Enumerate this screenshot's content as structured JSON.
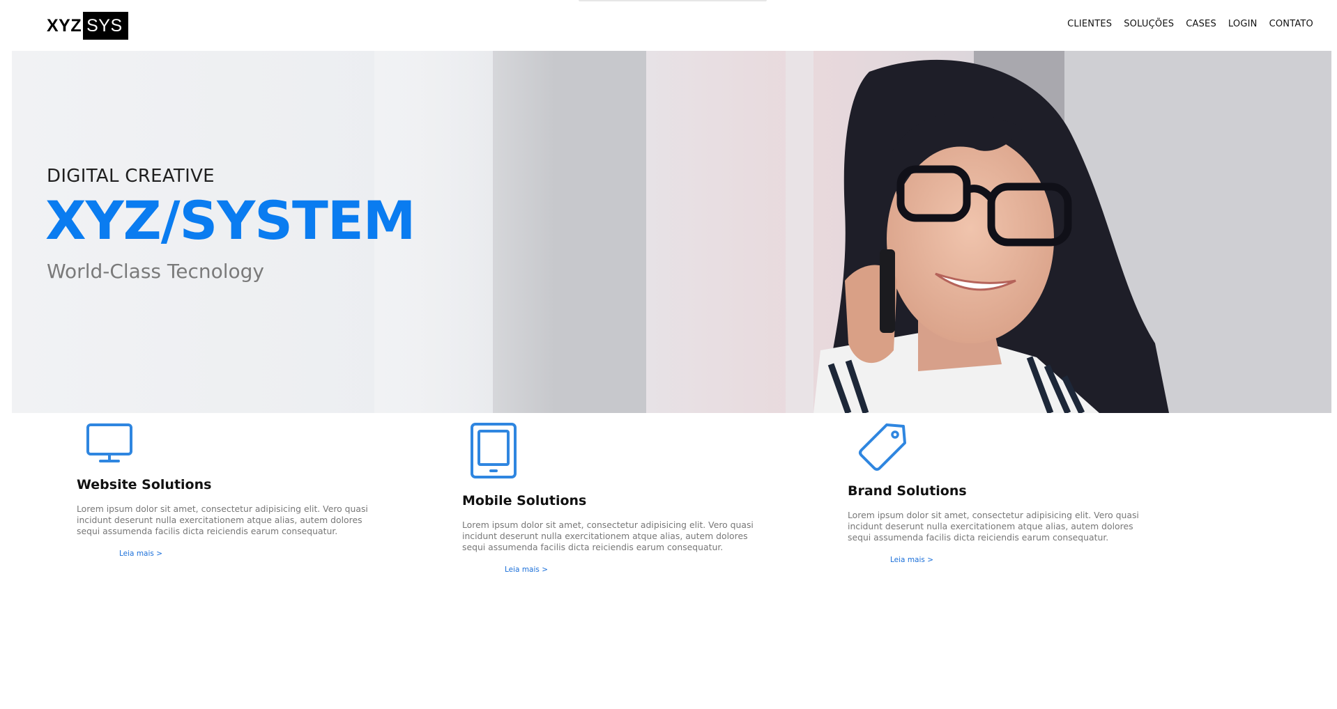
{
  "brand": {
    "logo_left": "XYZ",
    "logo_right": "SYS"
  },
  "nav": {
    "items": [
      "CLIENTES",
      "SOLUÇÕES",
      "CASES",
      "LOGIN",
      "CONTATO"
    ]
  },
  "hero": {
    "kicker": "DIGITAL CREATIVE",
    "title": "XYZ/SYSTEM",
    "subtitle": "World-Class Tecnology"
  },
  "features": [
    {
      "icon": "monitor-icon",
      "title": "Website Solutions",
      "text": "Lorem ipsum dolor sit amet, consectetur adipisicing elit. Vero quasi incidunt deserunt nulla exercitationem atque alias, autem dolores sequi assumenda facilis dicta reiciendis earum consequatur.",
      "link": "Leia mais >"
    },
    {
      "icon": "tablet-icon",
      "title": "Mobile Solutions",
      "text": "Lorem ipsum dolor sit amet, consectetur adipisicing elit. Vero quasi incidunt deserunt nulla exercitationem atque alias, autem dolores sequi assumenda facilis dicta reiciendis earum consequatur.",
      "link": "Leia mais >"
    },
    {
      "icon": "tag-icon",
      "title": "Brand Solutions",
      "text": "Lorem ipsum dolor sit amet, consectetur adipisicing elit. Vero quasi incidunt deserunt nulla exercitationem atque alias, autem dolores sequi assumenda facilis dicta reiciendis earum consequatur.",
      "link": "Leia mais >"
    }
  ],
  "colors": {
    "accent": "#0a7cf0",
    "icon": "#2f86e0",
    "link": "#1a6fd9"
  }
}
